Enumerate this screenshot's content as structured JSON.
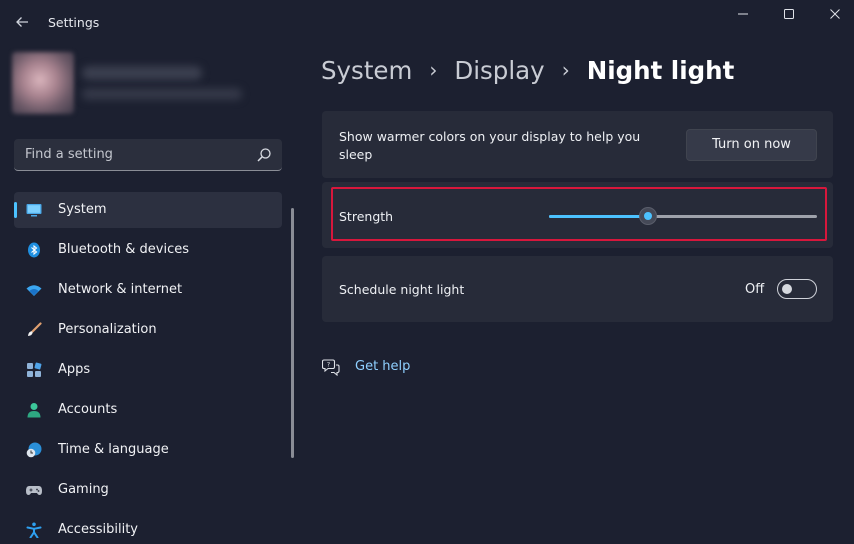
{
  "window": {
    "title": "Settings",
    "controls": [
      "minimize-icon",
      "maximize-icon",
      "close-icon"
    ]
  },
  "search": {
    "placeholder": "Find a setting"
  },
  "sidebar": {
    "items": [
      {
        "label": "System",
        "icon": "monitor-icon",
        "selected": true
      },
      {
        "label": "Bluetooth & devices",
        "icon": "bluetooth-icon"
      },
      {
        "label": "Network & internet",
        "icon": "wifi-icon"
      },
      {
        "label": "Personalization",
        "icon": "brush-icon"
      },
      {
        "label": "Apps",
        "icon": "apps-icon"
      },
      {
        "label": "Accounts",
        "icon": "person-icon"
      },
      {
        "label": "Time & language",
        "icon": "clock-globe-icon"
      },
      {
        "label": "Gaming",
        "icon": "gamepad-icon"
      },
      {
        "label": "Accessibility",
        "icon": "accessibility-icon"
      }
    ]
  },
  "breadcrumb": {
    "items": [
      "System",
      "Display",
      "Night light"
    ]
  },
  "main": {
    "turn_on": {
      "description": "Show warmer colors on your display to help you sleep",
      "button_label": "Turn on now"
    },
    "strength": {
      "label": "Strength",
      "value_percent": 37
    },
    "schedule": {
      "label": "Schedule night light",
      "state": "Off"
    },
    "help": {
      "label": "Get help"
    }
  },
  "colors": {
    "accent": "#4cc2ff",
    "highlight_border": "#d7173c",
    "background": "#1c2030",
    "card": "#272b39"
  }
}
